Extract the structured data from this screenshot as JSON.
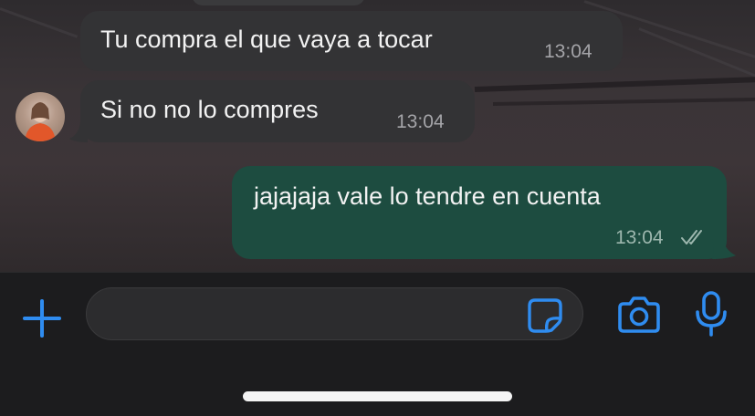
{
  "messages": [
    {
      "direction": "incoming",
      "text": "Tu compra el que vaya a tocar",
      "time": "13:04"
    },
    {
      "direction": "incoming",
      "text": "Si no no lo compres",
      "time": "13:04"
    },
    {
      "direction": "outgoing",
      "text": "jajajaja vale lo tendre en cuenta",
      "time": "13:04",
      "status": "read"
    }
  ],
  "composer": {
    "value": "",
    "placeholder": ""
  },
  "icons": {
    "attach": "plus-icon",
    "sticker": "sticker-icon",
    "camera": "camera-icon",
    "voice": "microphone-icon",
    "read_receipt": "double-check-icon"
  },
  "colors": {
    "accent": "#2f8cf0",
    "incoming_bubble": "#333335",
    "outgoing_bubble": "#1d4c40"
  }
}
